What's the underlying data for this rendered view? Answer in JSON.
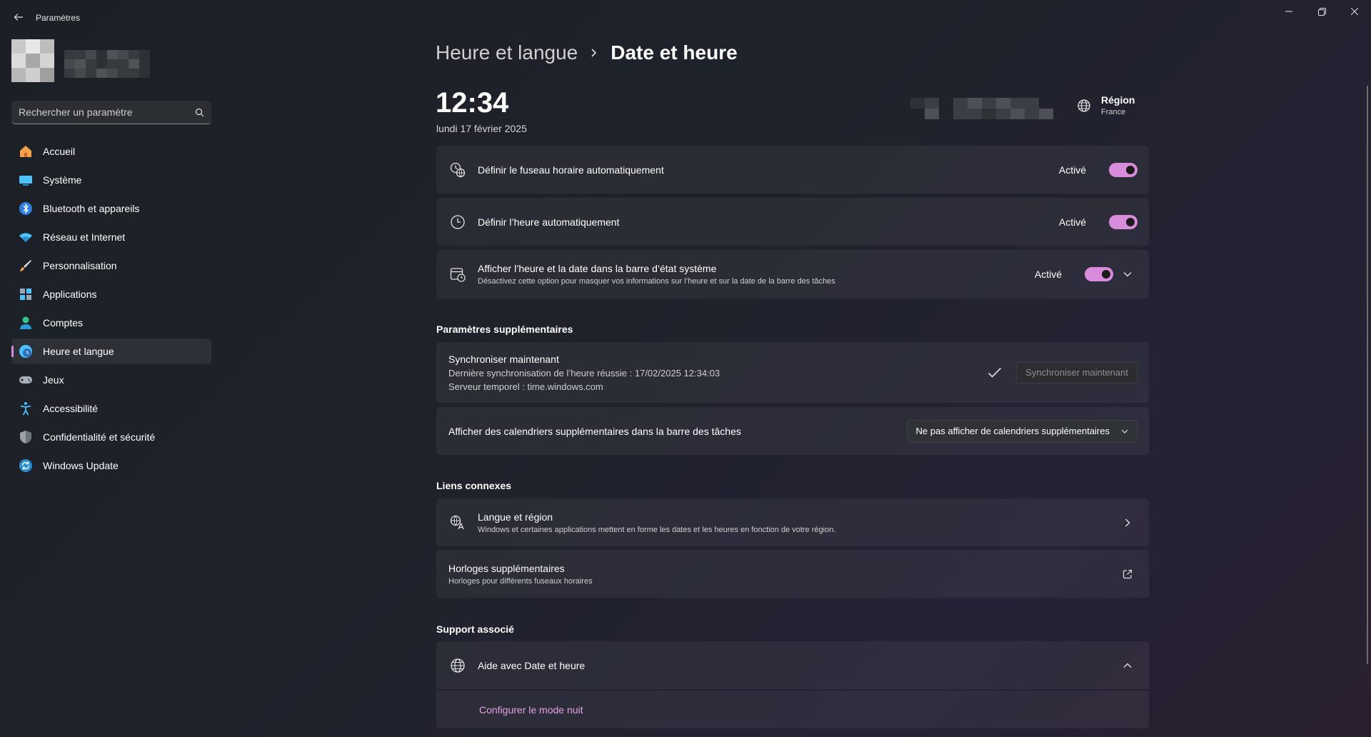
{
  "window": {
    "title": "Paramètres"
  },
  "search": {
    "placeholder": "Rechercher un paramètre"
  },
  "sidebar": {
    "items": [
      {
        "label": "Accueil",
        "icon": "home-icon"
      },
      {
        "label": "Système",
        "icon": "system-icon"
      },
      {
        "label": "Bluetooth et appareils",
        "icon": "bluetooth-icon"
      },
      {
        "label": "Réseau et Internet",
        "icon": "wifi-icon"
      },
      {
        "label": "Personnalisation",
        "icon": "brush-icon"
      },
      {
        "label": "Applications",
        "icon": "apps-icon"
      },
      {
        "label": "Comptes",
        "icon": "account-icon"
      },
      {
        "label": "Heure et langue",
        "icon": "time-language-icon",
        "active": true
      },
      {
        "label": "Jeux",
        "icon": "gamepad-icon"
      },
      {
        "label": "Accessibilité",
        "icon": "accessibility-icon"
      },
      {
        "label": "Confidentialité et sécurité",
        "icon": "shield-icon"
      },
      {
        "label": "Windows Update",
        "icon": "update-icon"
      }
    ]
  },
  "breadcrumb": {
    "parent": "Heure et langue",
    "current": "Date et heure"
  },
  "clock": {
    "time": "12:34",
    "date": "lundi 17 février 2025"
  },
  "region": {
    "title": "Région",
    "value": "France"
  },
  "settings": {
    "auto_timezone": {
      "title": "Définir le fuseau horaire automatiquement",
      "state": "Activé"
    },
    "auto_time": {
      "title": "Définir l’heure automatiquement",
      "state": "Activé"
    },
    "show_in_tray": {
      "title": "Afficher l’heure et la date dans la barre d’état système",
      "subtitle": "Désactivez cette option pour masquer vos informations sur l’heure et sur la date de la barre des tâches",
      "state": "Activé"
    }
  },
  "additional": {
    "section_title": "Paramètres supplémentaires",
    "sync": {
      "title": "Synchroniser maintenant",
      "last_sync": "Dernière synchronisation de l’heure réussie : 17/02/2025 12:34:03",
      "server": "Serveur temporel : time.windows.com",
      "button": "Synchroniser maintenant"
    },
    "calendars": {
      "title": "Afficher des calendriers supplémentaires dans la barre des tâches",
      "selected": "Ne pas afficher de calendriers supplémentaires"
    }
  },
  "related": {
    "section_title": "Liens connexes",
    "language_region": {
      "title": "Langue et région",
      "subtitle": "Windows et certaines applications mettent en forme les dates et les heures en fonction de votre région."
    },
    "extra_clocks": {
      "title": "Horloges supplémentaires",
      "subtitle": "Horloges pour différents fuseaux horaires"
    }
  },
  "support": {
    "section_title": "Support associé",
    "help": {
      "title": "Aide avec Date et heure",
      "link": "Configurer le mode nuit"
    }
  },
  "colors": {
    "accent": "#d98bdc",
    "link": "#e6a0e6"
  }
}
